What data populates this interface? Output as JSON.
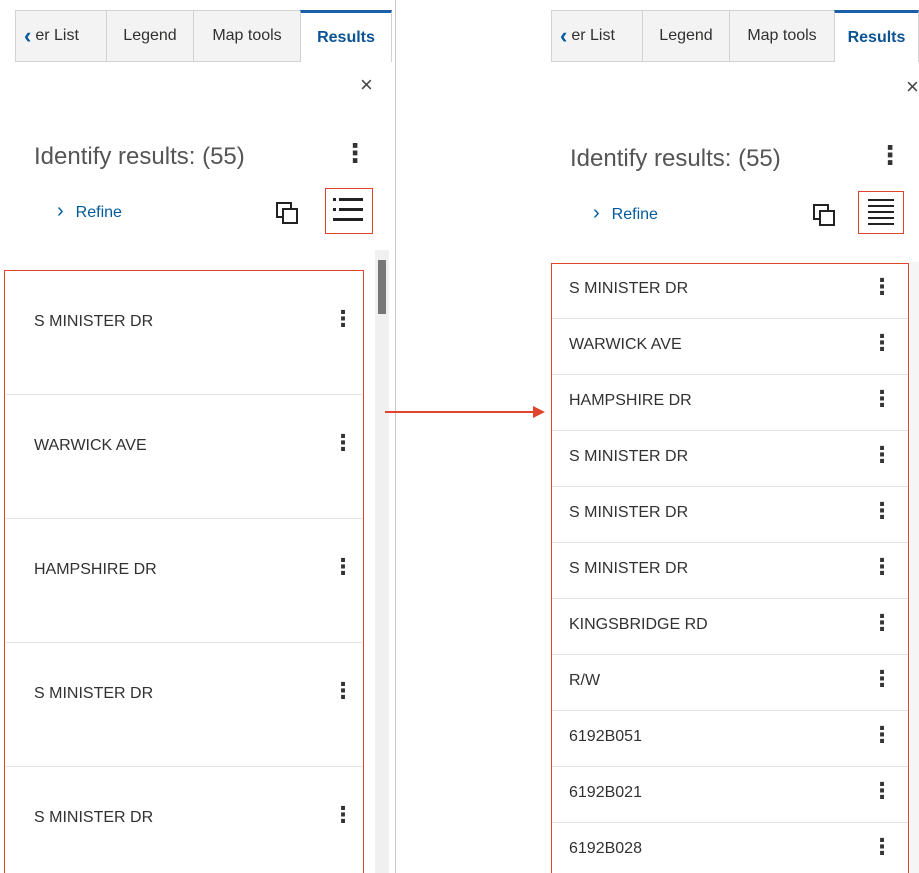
{
  "tabs": [
    {
      "label": "er List",
      "chevron": "‹"
    },
    {
      "label": "Legend"
    },
    {
      "label": "Map tools"
    },
    {
      "label": "Results"
    }
  ],
  "close_symbol": "×",
  "header": {
    "title": "Identify results: (55)",
    "refine": "Refine",
    "refine_arrow": "›"
  },
  "icons": [
    "chevron-left-icon",
    "close-icon",
    "more-vertical-icon",
    "chevron-right-icon",
    "copy-icon",
    "list-view-icon"
  ],
  "colors": {
    "highlight": "#e0442f",
    "link": "#005a9e",
    "active_tab": "#1a5fa8"
  },
  "left_list": [
    "S MINISTER DR",
    "WARWICK AVE",
    "HAMPSHIRE DR",
    "S MINISTER DR",
    "S MINISTER DR"
  ],
  "right_list": [
    "S MINISTER DR",
    "WARWICK AVE",
    "HAMPSHIRE DR",
    "S MINISTER DR",
    "S MINISTER DR",
    "S MINISTER DR",
    "KINGSBRIDGE RD",
    "R/W",
    "6192B051",
    "6192B021",
    "6192B028"
  ],
  "row_menu_symbol": "⋮"
}
